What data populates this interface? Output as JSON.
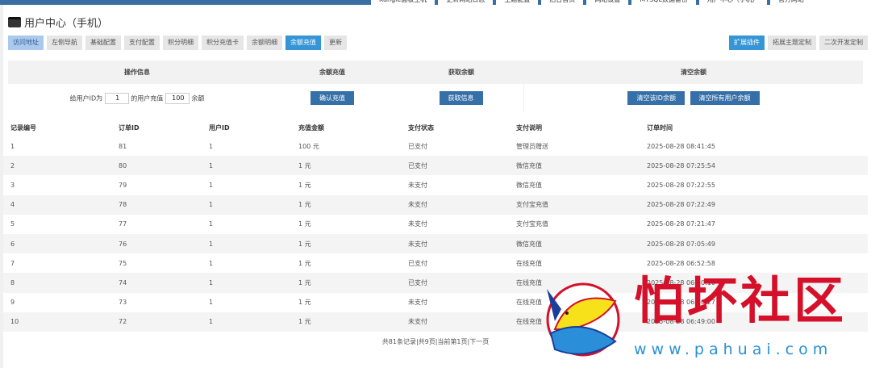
{
  "top_nav": [
    "Kangle面板主机",
    "更新网站日志",
    "主题配置",
    "后台首页",
    "网站设置",
    "MYSQL数据备份",
    "用户中心（手机）",
    "官方网站"
  ],
  "page_title": "用户中心（手机）",
  "tabs": [
    "访问地址",
    "左侧导航",
    "基础配置",
    "支付配置",
    "积分明细",
    "积分充值卡",
    "余额明细",
    "余额充值",
    "更新"
  ],
  "right_tabs": [
    "扩展插件",
    "拓展主题定制",
    "二次开发定制"
  ],
  "ops": {
    "headers": [
      "操作信息",
      "余额充值",
      "获取余额",
      "清空余额"
    ],
    "prefix": "给用户ID为",
    "user_id": "1",
    "middle": "的用户充值",
    "amount": "100",
    "suffix": "余额",
    "confirm": "确认充值",
    "get_info": "获取信息",
    "clear_id": "清空该ID余额",
    "clear_all": "清空所有用户余额"
  },
  "table": {
    "columns": [
      "记录编号",
      "订单ID",
      "用户ID",
      "充值金额",
      "支付状态",
      "支付说明",
      "订单时间"
    ],
    "rows": [
      [
        "1",
        "81",
        "1",
        "100 元",
        "已支付",
        "管理员赠送",
        "2025-08-28 08:41:45"
      ],
      [
        "2",
        "80",
        "1",
        "1 元",
        "已支付",
        "微信充值",
        "2025-08-28 07:25:54"
      ],
      [
        "3",
        "79",
        "1",
        "1 元",
        "未支付",
        "微信充值",
        "2025-08-28 07:22:55"
      ],
      [
        "4",
        "78",
        "1",
        "1 元",
        "未支付",
        "支付宝充值",
        "2025-08-28 07:22:49"
      ],
      [
        "5",
        "77",
        "1",
        "1 元",
        "未支付",
        "支付宝充值",
        "2025-08-28 07:21:47"
      ],
      [
        "6",
        "76",
        "1",
        "1 元",
        "未支付",
        "微信充值",
        "2025-08-28 07:05:49"
      ],
      [
        "7",
        "75",
        "1",
        "1 元",
        "已支付",
        "在线充值",
        "2025-08-28 06:52:58"
      ],
      [
        "8",
        "74",
        "1",
        "1 元",
        "已支付",
        "在线充值",
        "2025-08-28 06:50:10"
      ],
      [
        "9",
        "73",
        "1",
        "1 元",
        "未支付",
        "在线充值",
        "2025-08-28 06:50:27"
      ],
      [
        "10",
        "72",
        "1",
        "1 元",
        "未支付",
        "在线充值",
        "2025-08-28 06:49:00"
      ]
    ]
  },
  "pager": "共81条记录|共9页|当前第1页|下一页",
  "watermark": {
    "name": "怕坏社区",
    "url": "www.pahuai.com"
  }
}
